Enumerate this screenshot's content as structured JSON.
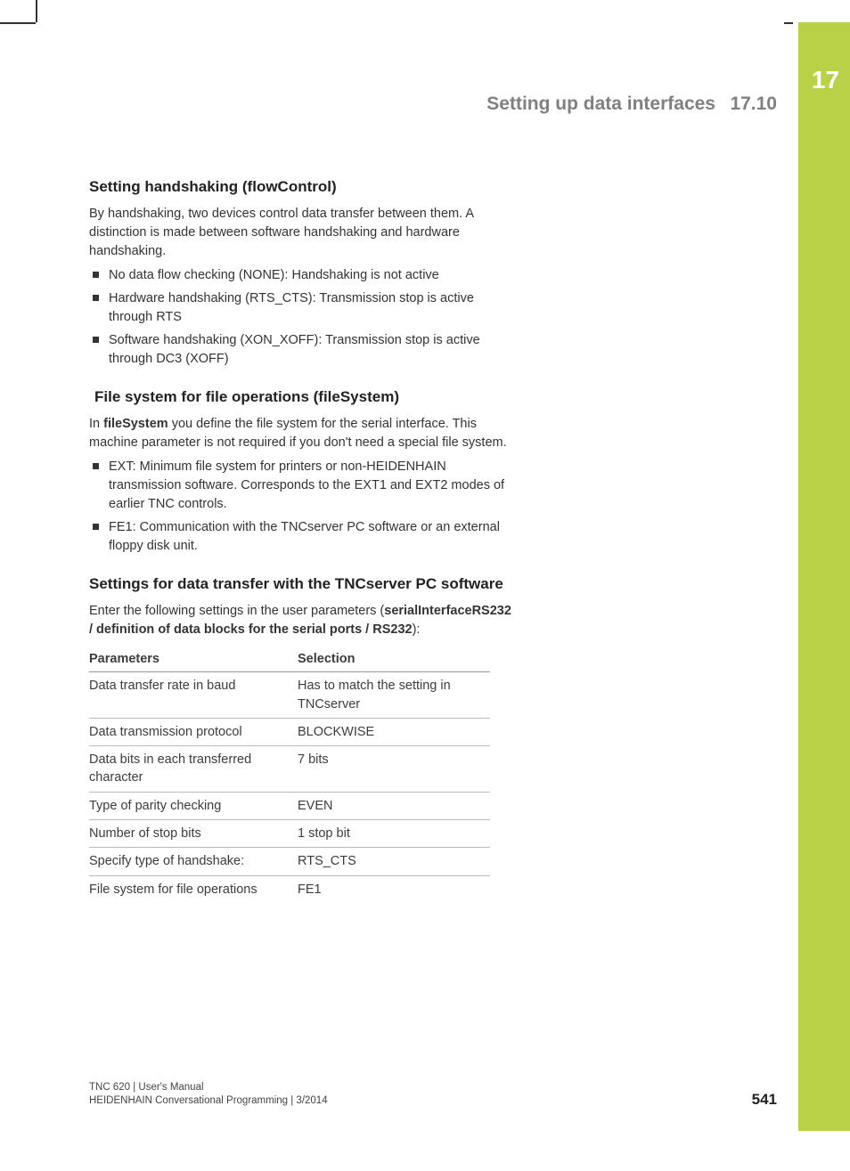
{
  "chapter": {
    "number": "17",
    "header_title": "Setting up data interfaces",
    "header_section": "17.10"
  },
  "section1": {
    "heading": "Setting handshaking (flowControl)",
    "para": "By handshaking, two devices control data transfer between them. A distinction is made between software handshaking and hardware handshaking.",
    "bullets": [
      "No data flow checking (NONE): Handshaking is not active",
      "Hardware handshaking (RTS_CTS): Transmission stop is active through RTS",
      "Software handshaking (XON_XOFF): Transmission stop is active through DC3 (XOFF)"
    ]
  },
  "section2": {
    "heading": "File system for file operations (fileSystem)",
    "para_pre": "In ",
    "para_bold": "fileSystem",
    "para_post": " you define the file system for the serial interface. This machine parameter is not required if you don't need a special file system.",
    "bullets": [
      "EXT: Minimum file system for printers or non-HEIDENHAIN transmission software. Corresponds to the EXT1 and EXT2 modes of earlier TNC controls.",
      "FE1: Communication with the TNCserver PC software or an external floppy disk unit."
    ]
  },
  "section3": {
    "heading": "Settings for data transfer with the TNCserver PC software",
    "para_pre": "Enter the following settings in the user parameters (",
    "para_bold": "serialInterfaceRS232 / definition of data blocks for the serial ports / RS232",
    "para_post": "):",
    "table": {
      "headers": [
        "Parameters",
        "Selection"
      ],
      "rows": [
        [
          "Data transfer rate in baud",
          "Has to match the setting in TNCserver"
        ],
        [
          "Data transmission protocol",
          "BLOCKWISE"
        ],
        [
          "Data bits in each transferred character",
          "7 bits"
        ],
        [
          "Type of parity checking",
          "EVEN"
        ],
        [
          "Number of stop bits",
          "1 stop bit"
        ],
        [
          "Specify type of handshake:",
          "RTS_CTS"
        ],
        [
          "File system for file operations",
          "FE1"
        ]
      ]
    }
  },
  "footer": {
    "line1": "TNC 620 | User's Manual",
    "line2": "HEIDENHAIN Conversational Programming | 3/2014"
  },
  "page_number": "541"
}
